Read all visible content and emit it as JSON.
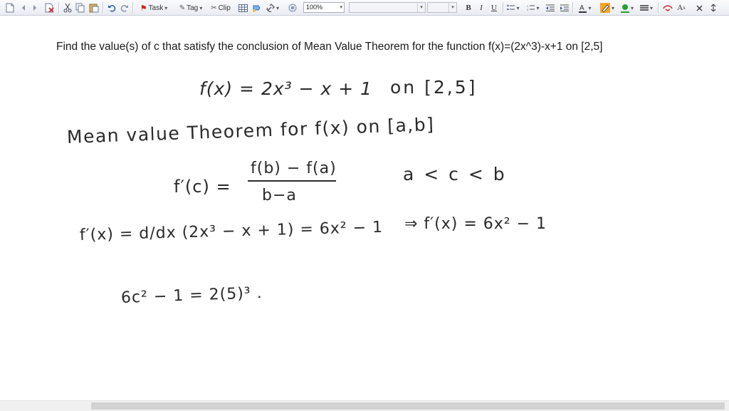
{
  "toolbar": {
    "task_label": "Task",
    "tag_label": "Tag",
    "clip_label": "Clip",
    "zoom_value": "100%",
    "bold_label": "B",
    "italic_label": "I",
    "underline_label": "U",
    "superscript_label": "A",
    "icons": [
      "new-page-icon",
      "back-icon",
      "forward-icon",
      "delete-icon",
      "cut-icon",
      "copy-icon",
      "paste-icon",
      "undo-icon",
      "redo-icon",
      "flag-icon",
      "pen-icon",
      "scissors-icon",
      "table-icon",
      "attach-icon",
      "link-icon",
      "zoom-icon",
      "bullets-icon",
      "numbering-icon",
      "indent-icon",
      "outdent-icon",
      "font-color-icon",
      "highlight-icon",
      "fill-color-icon",
      "line-style-icon",
      "eraser-icon",
      "close-icon",
      "more-icon"
    ],
    "colors": {
      "highlight": "#f5a623",
      "fill": "#2a9d3a",
      "font_color": "#333333"
    }
  },
  "question": {
    "text": "Find the value(s)  of c that satisfy  the conclusion  of Mean Value Theorem for the function  f(x)=(2x^3)-x+1 on [2,5]"
  },
  "work": {
    "line1": "f(x) = 2x³ − x + 1",
    "line1_interval": "on [2,5]",
    "line2": "Mean value Theorem for f(x) on [a,b]",
    "line3_lhs": "f′(c) =",
    "line3_num": "f(b) − f(a)",
    "line3_den": "b−a",
    "line3_cond": "a < c < b",
    "line4_lhs": "f′(x) = d/dx (2x³ − x + 1) = 6x² − 1",
    "line4_rhs": "⇒ f′(x) = 6x² − 1",
    "line5": "6c² − 1 = 2(5)³ ."
  }
}
